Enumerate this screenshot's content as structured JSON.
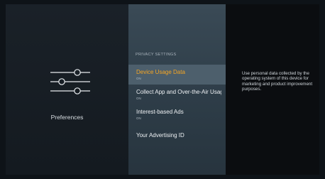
{
  "left_panel": {
    "label": "Preferences",
    "icon": "preferences-sliders-icon"
  },
  "middle_panel": {
    "header": "PRIVACY SETTINGS",
    "items": [
      {
        "title": "Device Usage Data",
        "status": "ON",
        "selected": true
      },
      {
        "title": "Collect App and Over-the-Air Usage",
        "status": "ON",
        "selected": false
      },
      {
        "title": "Interest-based Ads",
        "status": "ON",
        "selected": false
      },
      {
        "title": "Your Advertising ID",
        "status": "",
        "selected": false
      }
    ]
  },
  "right_panel": {
    "description": "Use personal data collected by the operating system of this device for marketing and product improvement purposes."
  },
  "colors": {
    "selected_title": "#f6a623",
    "selected_background": "#4d5f6c"
  }
}
